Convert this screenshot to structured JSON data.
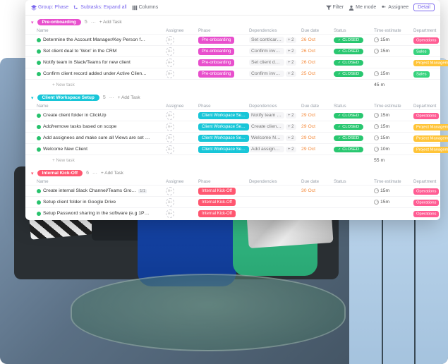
{
  "colors": {
    "purple": "#7b68ee",
    "magenta": "#e84fcd",
    "teal": "#18c6d8",
    "red": "#ff5670",
    "pink": "#ff5c93",
    "green_tag": "#37d37e",
    "yellow": "#ffc438"
  },
  "toolbar": {
    "group": "Group: Phase",
    "subtasks": "Subtasks: Expand all",
    "columns": "Columns",
    "filter": "Filter",
    "me": "Me mode",
    "assignee": "Assignee",
    "detail": "Detail"
  },
  "common": {
    "add_task": "+ Add Task",
    "assignee_placeholder": "A+",
    "new_task": "+ New task",
    "dep_more": "+ 2",
    "headers": {
      "name": "Name",
      "assignee": "Assignee",
      "phase": "Phase",
      "deps": "Dependencies",
      "due": "Due date",
      "status": "Status",
      "te": "Time estimate",
      "dept": "Department"
    }
  },
  "sections": [
    {
      "id": "pre",
      "label": "Pre-onboarding",
      "count": "5",
      "color_key": "magenta",
      "phase_color_key": "magenta",
      "tasks": [
        {
          "name": "Determine the Account Manager/Key Person f…",
          "dep": "Set cont/care to…",
          "due": "26 Oct",
          "status": "CLOSED",
          "te": "15m",
          "dept": "Operations",
          "dept_color_key": "pink"
        },
        {
          "name": "Set client deal to 'Won' in the CRM",
          "dep": "Confirm invoice h…",
          "due": "26 Oct",
          "status": "CLOSED",
          "te": "15m",
          "dept": "Sales",
          "dept_color_key": "green_tag"
        },
        {
          "name": "Notify team in Slack/Teams for new client",
          "dep": "Set client deal to…",
          "due": "26 Oct",
          "status": "CLOSED",
          "te": "",
          "dept": "Project Management",
          "dept_color_key": "yellow"
        },
        {
          "name": "Confirm client record added under Active Clien…",
          "dep": "Confirm invoice h…",
          "due": "25 Oct",
          "status": "CLOSED",
          "te": "15m",
          "dept": "Sales",
          "dept_color_key": "green_tag"
        }
      ],
      "footer_te": "45 m"
    },
    {
      "id": "cws",
      "label": "Client Workspace Setup",
      "count": "5",
      "color_key": "teal",
      "phase_color_key": "teal",
      "phase_label": "Client Workspace Se…",
      "tasks": [
        {
          "name": "Create client folder in ClickUp",
          "dep": "Notify team in Sla…",
          "due": "29 Oct",
          "status": "CLOSED",
          "te": "15m",
          "dept": "Operations",
          "dept_color_key": "pink"
        },
        {
          "name": "Add/remove tasks based on scope",
          "dep": "Create client fold…",
          "due": "29 Oct",
          "status": "CLOSED",
          "te": "15m",
          "dept": "Project Management",
          "dept_color_key": "yellow"
        },
        {
          "name": "Add assignees and make sure all Views are set …",
          "dep": "Welcome New Clie…",
          "due": "29 Oct",
          "status": "CLOSED",
          "te": "15m",
          "dept": "Project Management",
          "dept_color_key": "yellow"
        },
        {
          "name": "Welcome New Client",
          "dep": "Add assignees an…",
          "due": "29 Oct",
          "status": "CLOSED",
          "te": "10m",
          "dept": "Project Management",
          "dept_color_key": "yellow"
        }
      ],
      "footer_te": "55 m"
    },
    {
      "id": "iko",
      "label": "Internal Kick-Off",
      "count": "6",
      "color_key": "red",
      "phase_color_key": "red",
      "phase_label": "Internal Kick-Off",
      "tasks": [
        {
          "name": "Create internal Slack Channel/Teams Gro…",
          "sub": "1/1",
          "dep": "",
          "due": "30 Oct",
          "status": "",
          "te": "15m",
          "dept": "Operations",
          "dept_color_key": "pink"
        },
        {
          "name": "Setup client folder in Google Drive",
          "dep": "",
          "due": "",
          "status": "",
          "te": "15m",
          "dept": "Operations",
          "dept_color_key": "pink"
        },
        {
          "name": "Setup Password sharing in the software (e.g 1P…",
          "dep": "",
          "due": "",
          "status": "",
          "te": "",
          "dept": "Operations",
          "dept_color_key": "pink"
        }
      ]
    }
  ]
}
